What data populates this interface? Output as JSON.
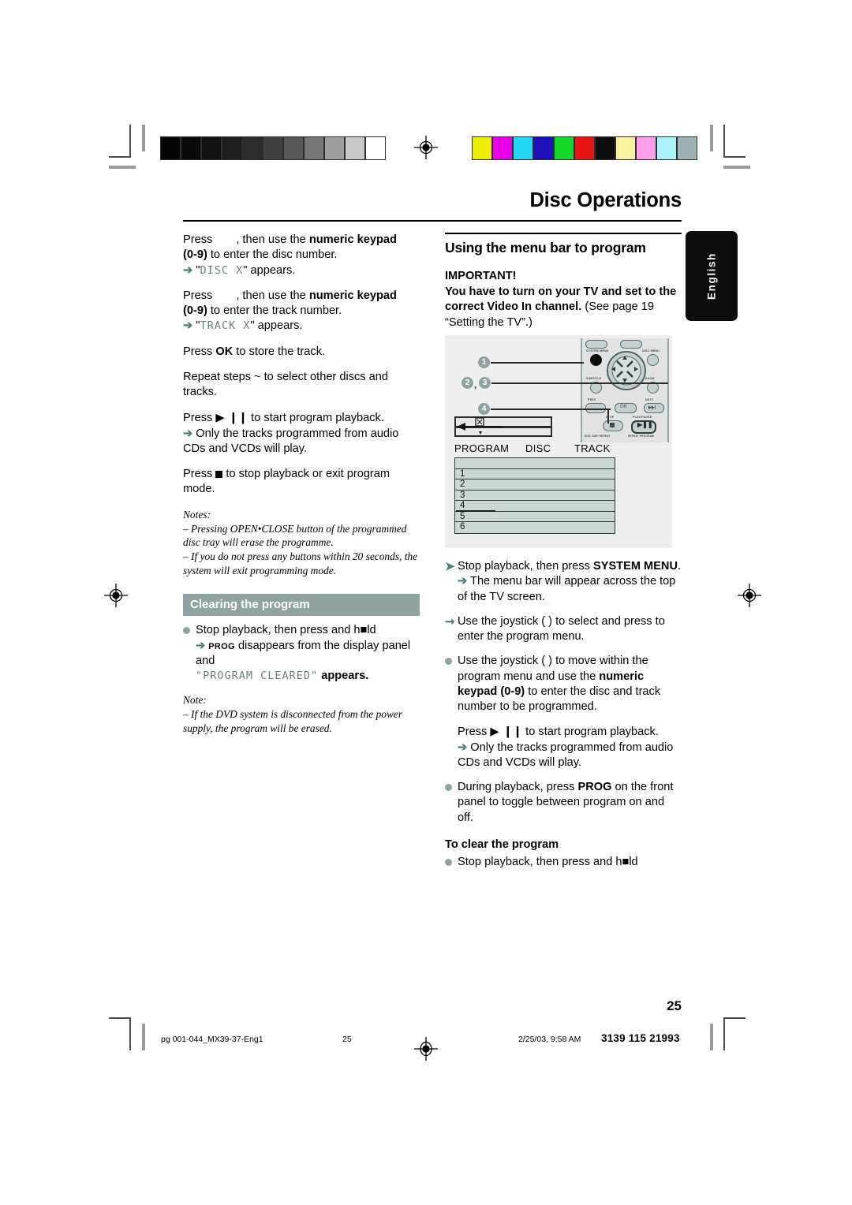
{
  "page": {
    "title": "Disc Operations",
    "number": "25",
    "language_tab": "English"
  },
  "colors": {
    "teal_accent": "#4f7f80",
    "section_bar": "#8fa3a3",
    "table_fill": "#ccd7d4",
    "tab_bg": "#0d0d0d"
  },
  "grayscale_strip": [
    "#050505",
    "#0a0a0a",
    "#141414",
    "#1f1f1f",
    "#2b2b2b",
    "#404040",
    "#565656",
    "#767676",
    "#9e9e9e",
    "#c8c8c8",
    "#ffffff"
  ],
  "color_strip": [
    "#eded00",
    "#e800e8",
    "#25d6f2",
    "#1d11bb",
    "#14d929",
    "#e81414",
    "#0d0d0d",
    "#f7f2a0",
    "#ff9ced",
    "#aaf2fb",
    "#9fb2b2"
  ],
  "left_column": {
    "step_disc": {
      "line1_pre": "Press",
      "line1_mid": ", then use the ",
      "line1_bold": "numeric keypad",
      "line2_bold": "(0-9)",
      "line2_rest": " to enter the disc number.",
      "result_arrow": "➔",
      "result_quote_open": "\"",
      "result_dot": "DISC X",
      "result_quote_close": "\" appears."
    },
    "step_track": {
      "line1_pre": "Press",
      "line1_mid": ", then use the ",
      "line1_bold": "numeric keypad",
      "line2_bold": "(0-9)",
      "line2_rest": " to enter the track number.",
      "result_arrow": "➔",
      "result_dot": "TRACK X",
      "result_quote_close": "\" appears."
    },
    "step_ok": {
      "pre": "Press ",
      "bold": "OK",
      "rest": " to store the track."
    },
    "step_repeat": "Repeat steps  ~    to select other discs and tracks.",
    "step_play": {
      "pre": "Press ",
      "glyph": "▶ ❙❙",
      "rest": " to start program playback.",
      "sub_arrow": "➔",
      "sub": " Only the tracks programmed from audio CDs and VCDs will play."
    },
    "step_stop": {
      "pre": "Press ",
      "glyph": "■",
      "rest": " to stop playback or exit program mode."
    },
    "notes_label": "Notes:",
    "notes": [
      "–  Pressing OPEN•CLOSE button of the programmed disc tray will erase the programme.",
      "–  If you do not press any buttons within 20 seconds, the system will exit programming mode."
    ],
    "clearing_header": "Clearing the program",
    "clearing_bullet": "Stop playback, then press and h■ld",
    "clearing_arrow": "➔",
    "clearing_prog": "PROG",
    "clearing_rest": " disappears from the display panel and",
    "clearing_quote": "\"PROGRAM CLEARED\"",
    "clearing_appears": " appears.",
    "note_label": "Note:",
    "note_text": "–  If the DVD system is disconnected from the power supply, the program will be erased."
  },
  "right_column": {
    "heading": "Using the menu bar to program",
    "important_label": "IMPORTANT!",
    "important_bold": "You have to turn on your TV and set to the correct Video In channel.",
    "important_regular": " (See page 19 “Setting the TV”.)",
    "illustration": {
      "callouts": [
        "1",
        "2",
        "3",
        "4"
      ],
      "comma": ",",
      "remote_labels": [
        "SYSTEM MENU",
        "DISC MENU",
        "SUBTITLE",
        "ZOOM",
        "PREV",
        "NEXT",
        "OK",
        "STOP",
        "PLAY/PAUSE",
        "DISC SKIP  REPEAT",
        "REPEAT   PROGRAM"
      ],
      "table_headers": [
        "PROGRAM",
        "DISC",
        "TRACK"
      ],
      "table_rows": [
        "",
        "1",
        "2",
        "3",
        "4",
        "5",
        "6"
      ]
    },
    "steps": [
      {
        "marker": "arrow",
        "pre": "Stop playback, then press ",
        "bold": "SYSTEM MENU",
        "post": ".",
        "sub_arrow": "➔",
        "sub": " The menu bar will appear across the top of the TV screen."
      },
      {
        "marker": "arrow2",
        "pre": "Use the joystick ( ",
        "bold": "",
        "post": " ) to select      and press       to enter the program menu."
      },
      {
        "marker": "dot",
        "pre": "Use the joystick (          ) to move within the program menu and use the ",
        "bold": "numeric keypad",
        "bold2": "(0-9)",
        "post": " to enter the disc and track number to be programmed."
      }
    ],
    "play_step": {
      "pre": "Press ",
      "glyph": "▶ ❙❙",
      "rest": " to start program playback.",
      "sub_arrow": "➔",
      "sub": " Only the tracks programmed from audio CDs and VCDs will play."
    },
    "prog_step": {
      "pre": "During playback, press ",
      "bold": "PROG",
      "post": " on the front panel to toggle between program on and off."
    },
    "clear_subhead": "To clear the program",
    "clear_bullet": "Stop playback, then press and h■ld"
  },
  "footer": {
    "file": "pg 001-044_MX39-37-Eng1",
    "page": "25",
    "date": "2/25/03, 9:58 AM",
    "code": "3139 115 21993"
  }
}
